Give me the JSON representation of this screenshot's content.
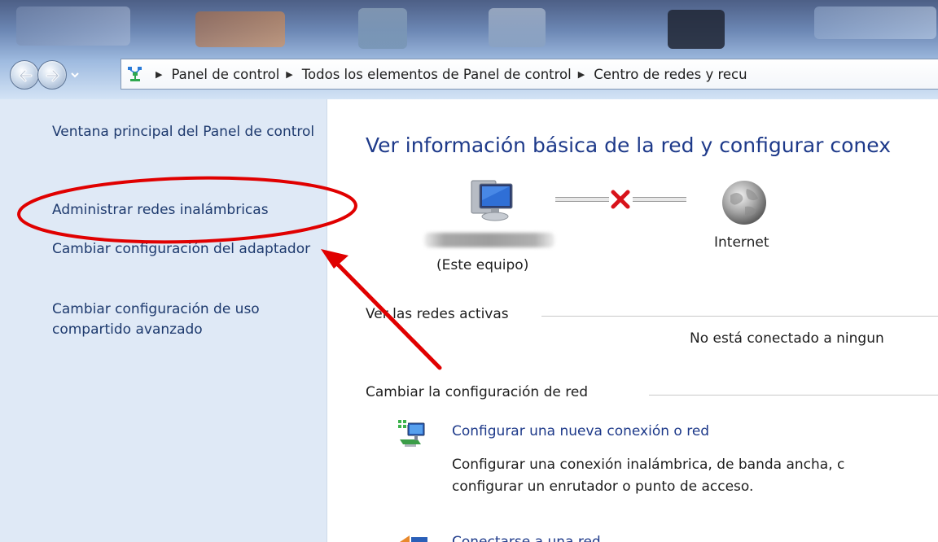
{
  "colors": {
    "link_blue": "#1e3a6e",
    "title_blue": "#1e3a8a",
    "sidebar_bg": "#dfe9f6",
    "annotation_red": "#e00000"
  },
  "navigation": {
    "back_icon": "back-arrow-icon",
    "forward_icon": "forward-arrow-icon",
    "recent_icon": "chevron-down-icon"
  },
  "breadcrumb": {
    "root_icon": "network-icon",
    "items": [
      "Panel de control",
      "Todos los elementos de Panel de control",
      "Centro de redes y recu"
    ]
  },
  "sidebar": {
    "links": [
      "Ventana principal del Panel de control",
      "Administrar redes inalámbricas",
      "Cambiar configuración del adaptador",
      "Cambiar configuración de uso compartido avanzado"
    ]
  },
  "main": {
    "title": "Ver información básica de la red y configurar conex",
    "map": {
      "this_computer_label": "(Este equipo)",
      "internet_label": "Internet",
      "status_icon": "red-x-icon"
    },
    "active_networks": {
      "title": "Ver las redes activas",
      "status": "No está conectado a ningun"
    },
    "change_settings": {
      "title": "Cambiar la configuración de red",
      "tasks": [
        {
          "link": "Configurar una nueva conexión o red",
          "description_line1": "Configurar una conexión inalámbrica, de banda ancha, c",
          "description_line2": "configurar un enrutador o punto de acceso."
        },
        {
          "link": "Conectarse a una red"
        }
      ]
    }
  }
}
